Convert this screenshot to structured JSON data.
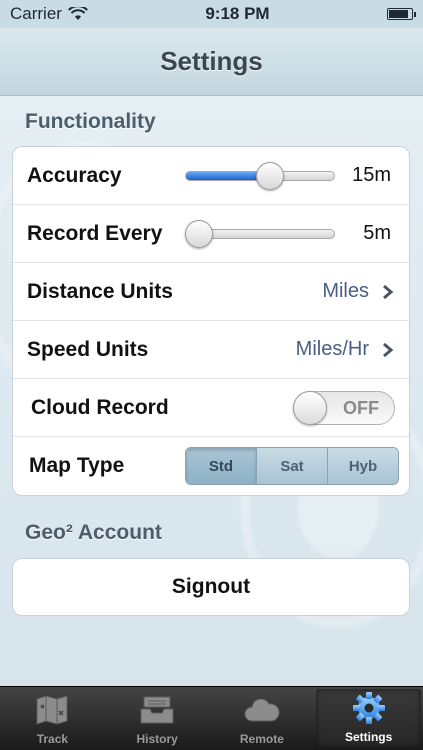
{
  "status_bar": {
    "carrier": "Carrier",
    "time": "9:18 PM"
  },
  "nav": {
    "title": "Settings"
  },
  "sections": {
    "functionality": "Functionality",
    "account": "Geo² Account"
  },
  "rows": {
    "accuracy": {
      "label": "Accuracy",
      "value": "15m",
      "slider_fraction": 0.58
    },
    "record_every": {
      "label": "Record Every",
      "value": "5m",
      "slider_fraction": 0.0
    },
    "distance_units": {
      "label": "Distance Units",
      "value": "Miles"
    },
    "speed_units": {
      "label": "Speed Units",
      "value": "Miles/Hr"
    },
    "cloud_record": {
      "label": "Cloud Record",
      "toggle_text": "OFF"
    },
    "map_type": {
      "label": "Map Type",
      "options": [
        "Std",
        "Sat",
        "Hyb"
      ],
      "selected": "Std"
    }
  },
  "signout_label": "Signout",
  "tabs": [
    {
      "label": "Track",
      "icon": "map-icon"
    },
    {
      "label": "History",
      "icon": "inbox-tray-icon"
    },
    {
      "label": "Remote",
      "icon": "cloud-icon"
    },
    {
      "label": "Settings",
      "icon": "gear-icon",
      "active": true
    }
  ],
  "colors": {
    "accent": "#1b63d1",
    "value_text": "#4a5f85"
  }
}
